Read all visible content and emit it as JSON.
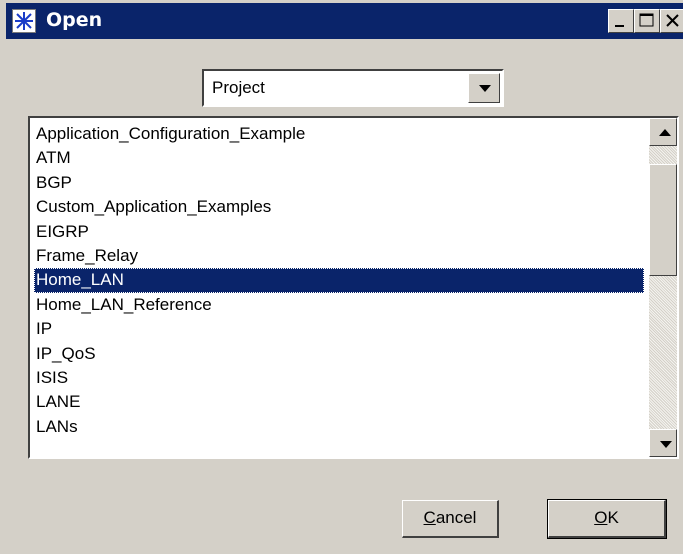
{
  "window": {
    "title": "Open",
    "icon": "star-app-icon",
    "controls": [
      "minimize-icon",
      "maximize-icon",
      "close-icon"
    ]
  },
  "filter": {
    "selected": "Project"
  },
  "list": {
    "items": [
      "Application_Configuration_Example",
      "ATM",
      "BGP",
      "Custom_Application_Examples",
      "EIGRP",
      "Frame_Relay",
      "Home_LAN",
      "Home_LAN_Reference",
      "IP",
      "IP_QoS",
      "ISIS",
      "LANE",
      "LANs"
    ],
    "selected_index": 6
  },
  "buttons": {
    "cancel": {
      "accel": "C",
      "rest": "ancel"
    },
    "ok": {
      "accel": "O",
      "rest": "K"
    }
  },
  "colors": {
    "titlebar": "#0a246a",
    "selection": "#0a246a",
    "face": "#d4d0c8"
  }
}
